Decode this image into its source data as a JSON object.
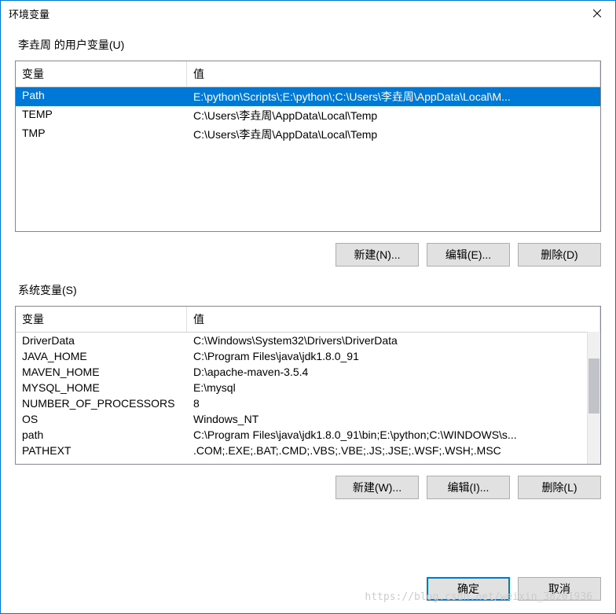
{
  "window": {
    "title": "环境变量"
  },
  "userVars": {
    "label": "李垚周 的用户变量(U)",
    "headers": {
      "name": "变量",
      "value": "值"
    },
    "rows": [
      {
        "name": "Path",
        "value": "E:\\python\\Scripts\\;E:\\python\\;C:\\Users\\李垚周\\AppData\\Local\\M..."
      },
      {
        "name": "TEMP",
        "value": "C:\\Users\\李垚周\\AppData\\Local\\Temp"
      },
      {
        "name": "TMP",
        "value": "C:\\Users\\李垚周\\AppData\\Local\\Temp"
      }
    ],
    "buttons": {
      "new": "新建(N)...",
      "edit": "编辑(E)...",
      "delete": "删除(D)"
    }
  },
  "systemVars": {
    "label": "系统变量(S)",
    "headers": {
      "name": "变量",
      "value": "值"
    },
    "rows": [
      {
        "name": "DriverData",
        "value": "C:\\Windows\\System32\\Drivers\\DriverData"
      },
      {
        "name": "JAVA_HOME",
        "value": "C:\\Program Files\\java\\jdk1.8.0_91"
      },
      {
        "name": "MAVEN_HOME",
        "value": "D:\\apache-maven-3.5.4"
      },
      {
        "name": "MYSQL_HOME",
        "value": "E:\\mysql"
      },
      {
        "name": "NUMBER_OF_PROCESSORS",
        "value": "8"
      },
      {
        "name": "OS",
        "value": "Windows_NT"
      },
      {
        "name": "path",
        "value": "C:\\Program Files\\java\\jdk1.8.0_91\\bin;E:\\python;C:\\WINDOWS\\s..."
      },
      {
        "name": "PATHEXT",
        "value": ".COM;.EXE;.BAT;.CMD;.VBS;.VBE;.JS;.JSE;.WSF;.WSH;.MSC"
      }
    ],
    "buttons": {
      "new": "新建(W)...",
      "edit": "编辑(I)...",
      "delete": "删除(L)"
    }
  },
  "dialog": {
    "ok": "确定",
    "cancel": "取消"
  },
  "watermark": "https://blog.csdn.net/weixin_38201936"
}
